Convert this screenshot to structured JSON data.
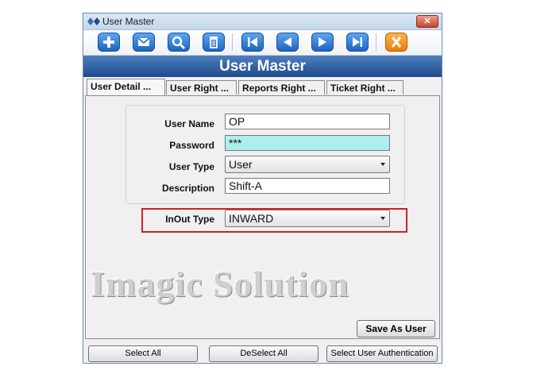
{
  "window": {
    "title": "User Master",
    "close_label": "✕"
  },
  "toolbar": {
    "buttons": [
      {
        "icon": "plus-icon"
      },
      {
        "icon": "mail-icon"
      },
      {
        "icon": "search-icon"
      },
      {
        "icon": "trash-icon"
      },
      {
        "icon": "first-record-icon"
      },
      {
        "icon": "previous-record-icon"
      },
      {
        "icon": "next-record-icon"
      },
      {
        "icon": "last-record-icon"
      },
      {
        "icon": "close-icon"
      }
    ]
  },
  "header": {
    "title": "User Master"
  },
  "tabs": [
    {
      "label": "User Detail ..."
    },
    {
      "label": "User Right ..."
    },
    {
      "label": "Reports Right ..."
    },
    {
      "label": "Ticket Right ..."
    }
  ],
  "form": {
    "user_name_label": "User Name",
    "user_name_value": "OP",
    "password_label": "Password",
    "password_value": "***",
    "user_type_label": "User Type",
    "user_type_value": "User",
    "description_label": "Description",
    "description_value": "Shift-A",
    "inout_type_label": "InOut Type",
    "inout_type_value": "INWARD"
  },
  "watermark": "Imagic Solution",
  "buttons": {
    "save_as_user": "Save As User",
    "select_all": "Select All",
    "deselect_all": "DeSelect All",
    "select_user_authentication": "Select User Authentication"
  },
  "colors": {
    "accent": "#2a5ba0",
    "password_bg": "#aeeeec",
    "highlight": "#d32020",
    "toolbar_blue": "#1f64c4",
    "toolbar_orange": "#f07b06"
  }
}
